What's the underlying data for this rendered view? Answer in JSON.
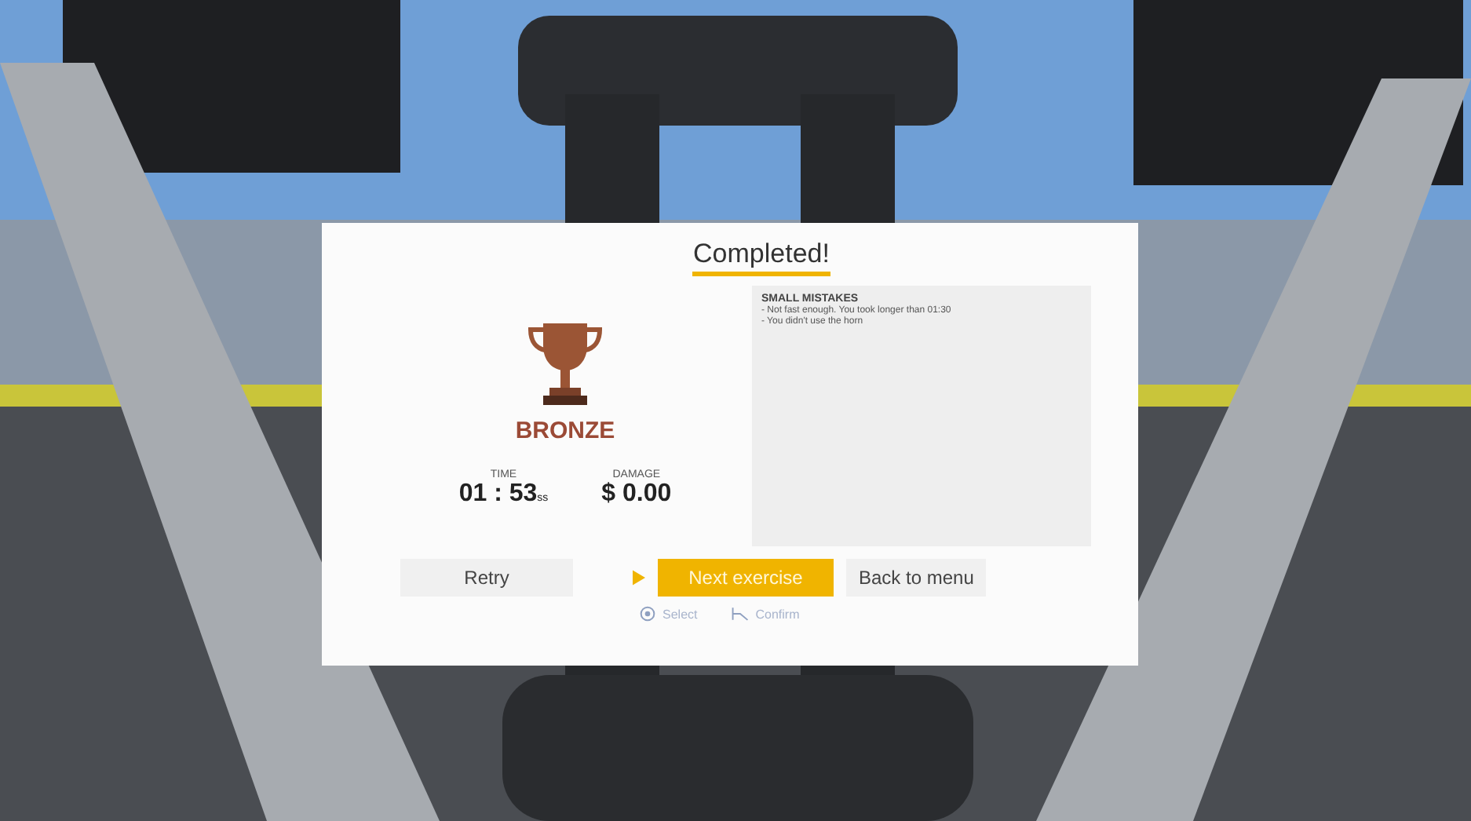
{
  "result": {
    "title": "Completed!",
    "medal": "BRONZE",
    "stats": [
      {
        "label": "TIME",
        "value": "01 : 53",
        "unit": "ss"
      },
      {
        "label": "DAMAGE",
        "value": "$ 0.00"
      }
    ],
    "feedback": {
      "heading": "SMALL MISTAKES",
      "lines": [
        "- Not fast enough. You took longer than 01:30",
        "- You didn't use the horn"
      ]
    },
    "buttons": [
      {
        "label": "Retry",
        "selected": false
      },
      {
        "label": "Next exercise",
        "selected": true
      },
      {
        "label": "Back to menu",
        "selected": false
      }
    ],
    "hints": [
      {
        "kind": "select",
        "label": "Select"
      },
      {
        "kind": "confirm",
        "label": "Confirm"
      }
    ]
  }
}
